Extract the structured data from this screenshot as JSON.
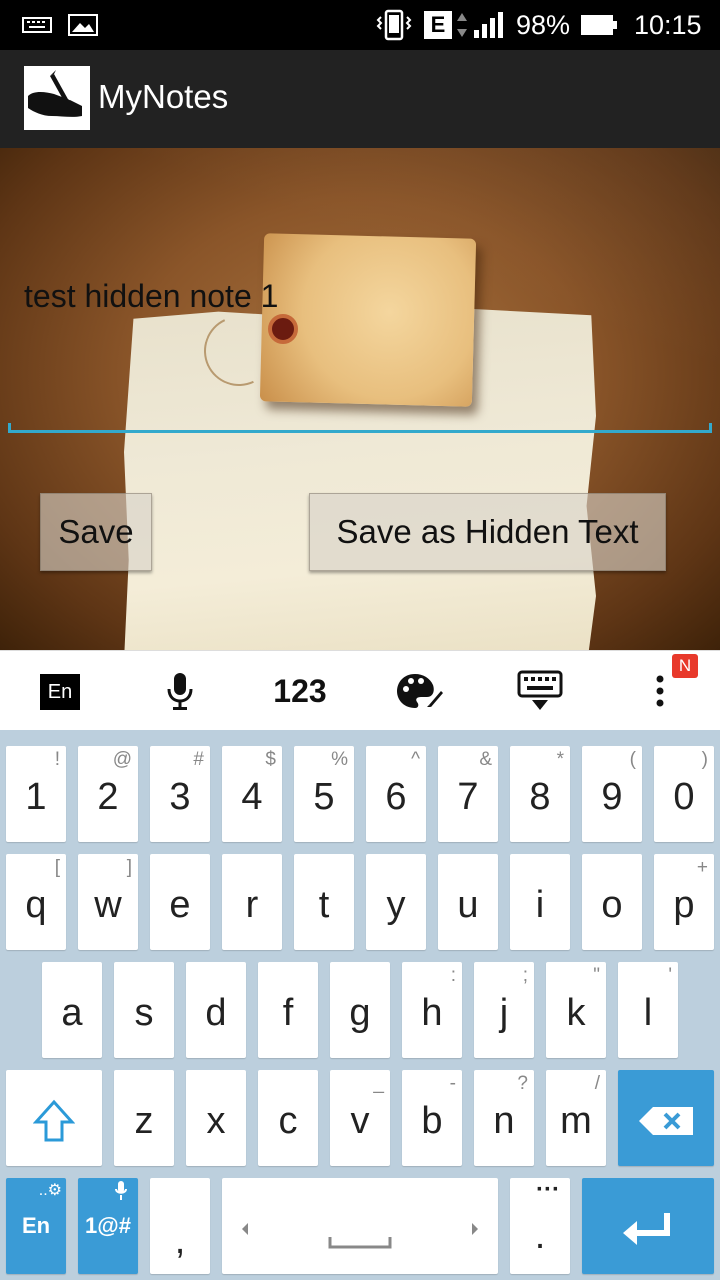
{
  "status_bar": {
    "network_type": "E",
    "battery": "98%",
    "time": "10:15"
  },
  "action_bar": {
    "title": "MyNotes"
  },
  "note": {
    "text": "test hidden note 1"
  },
  "buttons": {
    "save": "Save",
    "save_hidden": "Save as Hidden Text"
  },
  "keyboard_toolbar": {
    "lang": "En",
    "numbers": "123",
    "badge": "N"
  },
  "keyboard": {
    "row1": [
      {
        "main": "1",
        "sub": "!"
      },
      {
        "main": "2",
        "sub": "@"
      },
      {
        "main": "3",
        "sub": "#"
      },
      {
        "main": "4",
        "sub": "$"
      },
      {
        "main": "5",
        "sub": "%"
      },
      {
        "main": "6",
        "sub": "^"
      },
      {
        "main": "7",
        "sub": "&"
      },
      {
        "main": "8",
        "sub": "*"
      },
      {
        "main": "9",
        "sub": "("
      },
      {
        "main": "0",
        "sub": ")"
      }
    ],
    "row2": [
      {
        "main": "q",
        "sub": "["
      },
      {
        "main": "w",
        "sub": "]"
      },
      {
        "main": "e",
        "sub": ""
      },
      {
        "main": "r",
        "sub": ""
      },
      {
        "main": "t",
        "sub": ""
      },
      {
        "main": "y",
        "sub": ""
      },
      {
        "main": "u",
        "sub": ""
      },
      {
        "main": "i",
        "sub": ""
      },
      {
        "main": "o",
        "sub": ""
      },
      {
        "main": "p",
        "sub": "+"
      }
    ],
    "row3": [
      {
        "main": "a",
        "sub": ""
      },
      {
        "main": "s",
        "sub": ""
      },
      {
        "main": "d",
        "sub": ""
      },
      {
        "main": "f",
        "sub": ""
      },
      {
        "main": "g",
        "sub": ""
      },
      {
        "main": "h",
        "sub": ":"
      },
      {
        "main": "j",
        "sub": ";"
      },
      {
        "main": "k",
        "sub": "\""
      },
      {
        "main": "l",
        "sub": "'"
      }
    ],
    "row4": [
      {
        "main": "z",
        "sub": ""
      },
      {
        "main": "x",
        "sub": ""
      },
      {
        "main": "c",
        "sub": ""
      },
      {
        "main": "v",
        "sub": "_"
      },
      {
        "main": "b",
        "sub": "-"
      },
      {
        "main": "n",
        "sub": "?"
      },
      {
        "main": "m",
        "sub": "/"
      }
    ],
    "lang_key": "En",
    "symbols_key": "1@#",
    "comma": ",",
    "period": "."
  }
}
